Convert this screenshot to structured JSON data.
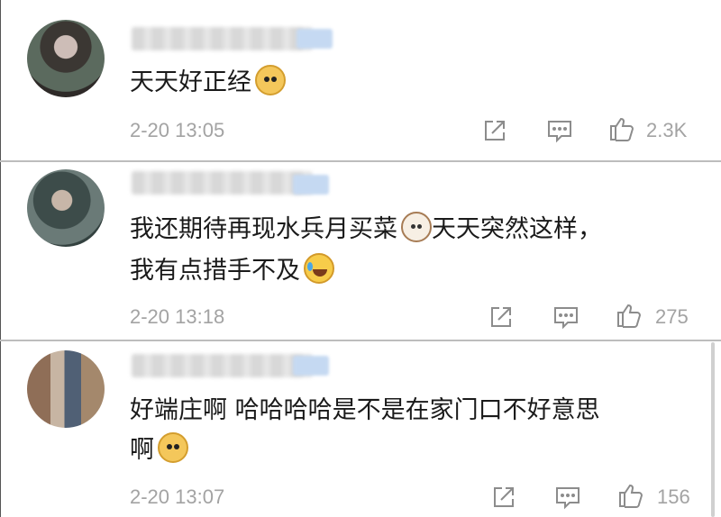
{
  "comments": [
    {
      "text": "天天好正经",
      "emoji_after": "doge-emoji",
      "time": "2-20 13:05",
      "likes": "2.3K"
    },
    {
      "line1_a": "我还期待再现水兵月买菜",
      "line1_emoji": "cat-emoji",
      "line1_b": "天天突然这样，",
      "line2": "我有点措手不及",
      "line2_emoji": "laugh-cry-emoji",
      "time": "2-20 13:18",
      "likes": "275"
    },
    {
      "line1": "好端庄啊 哈哈哈哈是不是在家门口不好意思",
      "line2": "啊",
      "line2_emoji": "doge-emoji",
      "time": "2-20 13:07",
      "likes": "156"
    }
  ],
  "icons": {
    "share": "share-icon",
    "comment": "comment-icon",
    "like": "thumbs-up-icon"
  },
  "colors": {
    "text": "#1a1a1a",
    "meta": "#a3a3a3",
    "icon": "#8c8c8c",
    "separator": "#bdbdbd"
  }
}
